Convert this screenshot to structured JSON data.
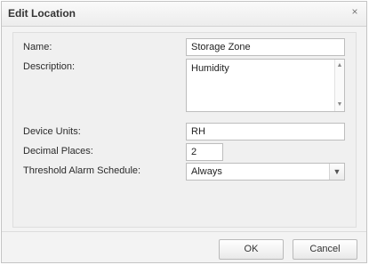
{
  "dialog": {
    "title": "Edit Location",
    "close_label": "×"
  },
  "form": {
    "name_label": "Name:",
    "name_value": "Storage Zone",
    "description_label": "Description:",
    "description_value": "Humidity",
    "device_units_label": "Device Units:",
    "device_units_value": "RH",
    "decimal_places_label": "Decimal Places:",
    "decimal_places_value": "2",
    "schedule_label": "Threshold Alarm Schedule:",
    "schedule_value": "Always"
  },
  "buttons": {
    "ok_label": "OK",
    "cancel_label": "Cancel"
  },
  "icons": {
    "close": "close-icon",
    "dropdown": "chevron-down-icon",
    "scroll_up": "scroll-up-icon",
    "scroll_down": "scroll-down-icon"
  }
}
